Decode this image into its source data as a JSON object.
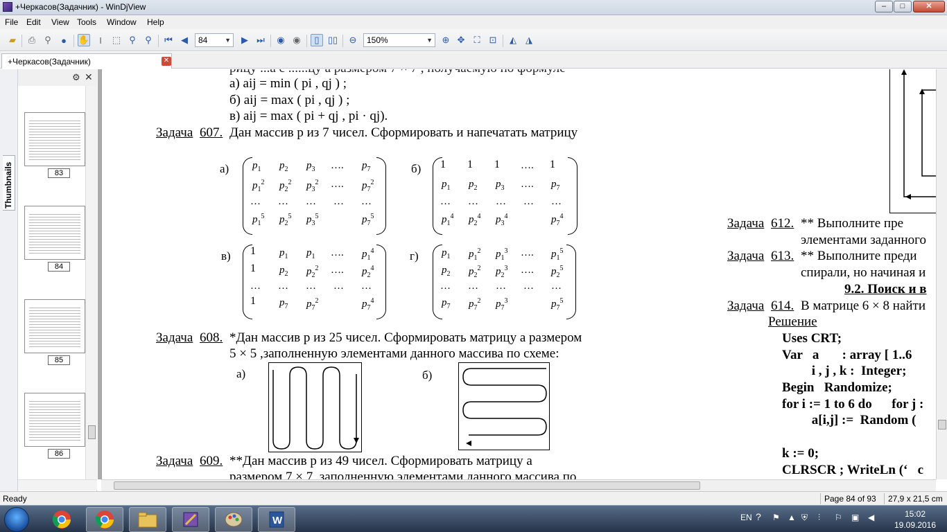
{
  "window": {
    "title": "+Черкасов(Задачник) - WinDjView",
    "buttons": [
      "–",
      "□",
      "✕"
    ]
  },
  "menu": [
    "File",
    "Edit",
    "View",
    "Tools",
    "Window",
    "Help"
  ],
  "toolbar": {
    "page_value": "84",
    "zoom_value": "150%"
  },
  "tab": {
    "label": "+Черкасов(Задачник)"
  },
  "sidebar": {
    "tab_label": "Thumbnails",
    "thumbnails": [
      "83",
      "84",
      "85",
      "86"
    ]
  },
  "doc": {
    "top_cut": "рицу ...а с ......цу а размером 7 × 7 , получаемую по формуле",
    "line_a": "а) aij = min ( pi , qj ) ;",
    "line_b": "б) aij = max ( pi , qj ) ;",
    "line_v": "в) aij = max ( pi + qj , pi · qj).",
    "t607_label": "Задача",
    "t607_num": "607.",
    "t607_text": "Дан массив  p из 7  чисел. Сформировать и напечатать матрицу",
    "mat_labels": [
      "а)",
      "б)",
      "в)",
      "г)"
    ],
    "dots": "….",
    "ellipsis": "…",
    "t608_label": "Задача",
    "t608_num": "608.",
    "t608_text1": "*Дан массив  p из 25 чисел. Сформировать матрицу a размером",
    "t608_text2": "5 × 5 ,заполненную элементами данного массива по схеме:",
    "scheme_a": "а)",
    "scheme_b": "б)",
    "t609_label": "Задача",
    "t609_num": "609.",
    "t609_text1": "**Дан  массив     p   из   49   чисел.  Сформировать  матрицу   a",
    "t609_text2": "размером 7 × 7 ,заполненную элементами  данного массива по",
    "right": {
      "t612_label": "Задача",
      "t612_num": "612.",
      "t612_text1": "**   Выполните   пре",
      "t612_text2": "элементами заданного",
      "t613_label": "Задача",
      "t613_num": "613.",
      "t613_text1": "**  Выполните  преди",
      "t613_text2": "спирали, но начиная и",
      "section": "9.2. Поиск и в",
      "t614_label": "Задача",
      "t614_num": "614.",
      "t614_text": "В матрице 6 × 8 найти",
      "solution": "Решение",
      "code": [
        "Uses CRT;",
        "Var   a       : array [ 1..6",
        "         i , j , k :  Integer;",
        "Begin   Randomize;",
        "for i := 1 to 6 do      for j :",
        "         a[i,j] :=  Random (",
        "",
        "k := 0;",
        "CLRSCR ; WriteLn (‘   c"
      ]
    }
  },
  "status": {
    "ready": "Ready",
    "page": "Page 84 of 93",
    "size": "27,9 x 21,5 cm"
  },
  "taskbar": {
    "lang": "EN",
    "time": "15:02",
    "date": "19.09.2016"
  }
}
